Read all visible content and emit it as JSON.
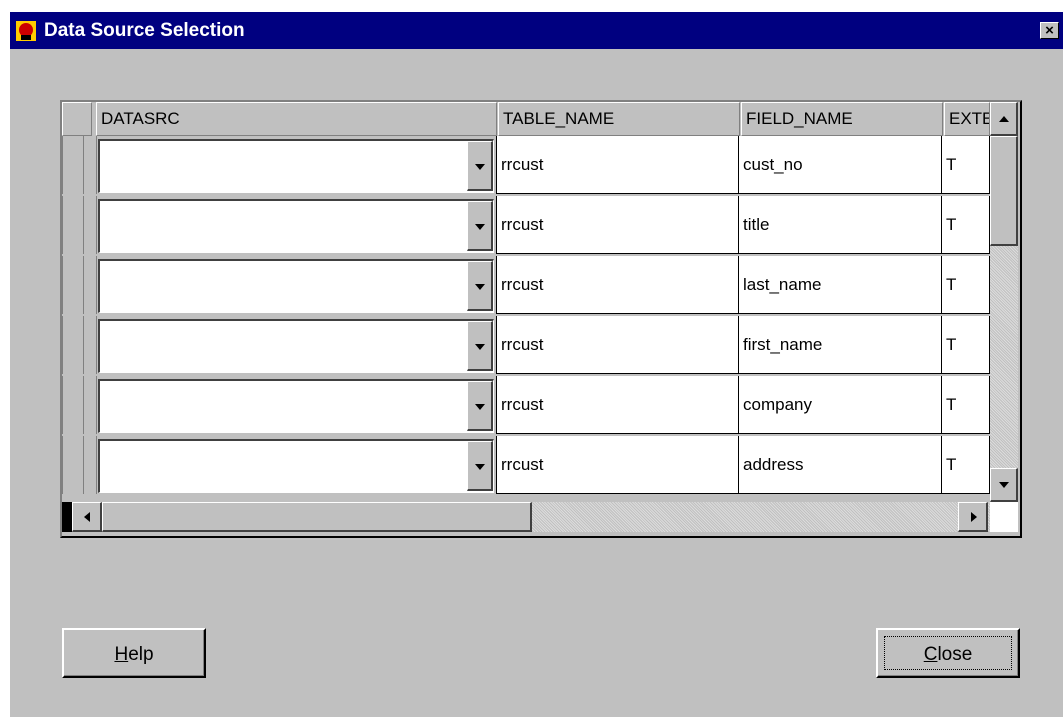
{
  "window": {
    "title": "Data Source Selection",
    "close_glyph": "×"
  },
  "grid": {
    "columns": [
      "DATASRC",
      "TABLE_NAME",
      "FIELD_NAME",
      "EXTE"
    ],
    "rows": [
      {
        "datasrc": "",
        "table_name": "rrcust",
        "field_name": "cust_no",
        "ext": "T"
      },
      {
        "datasrc": "",
        "table_name": "rrcust",
        "field_name": "title",
        "ext": "T"
      },
      {
        "datasrc": "",
        "table_name": "rrcust",
        "field_name": "last_name",
        "ext": "T"
      },
      {
        "datasrc": "",
        "table_name": "rrcust",
        "field_name": "first_name",
        "ext": "T"
      },
      {
        "datasrc": "",
        "table_name": "rrcust",
        "field_name": "company",
        "ext": "T"
      },
      {
        "datasrc": "",
        "table_name": "rrcust",
        "field_name": "address",
        "ext": "T"
      }
    ]
  },
  "buttons": {
    "help": {
      "mnemonic": "H",
      "rest": "elp"
    },
    "close": {
      "mnemonic": "C",
      "rest": "lose"
    }
  },
  "colors": {
    "titlebar": "#000080",
    "face": "#c0c0c0"
  },
  "icons": [
    "app-icon",
    "close-icon",
    "dropdown-arrow-icon",
    "scroll-up-icon",
    "scroll-down-icon",
    "scroll-left-icon",
    "scroll-right-icon"
  ]
}
